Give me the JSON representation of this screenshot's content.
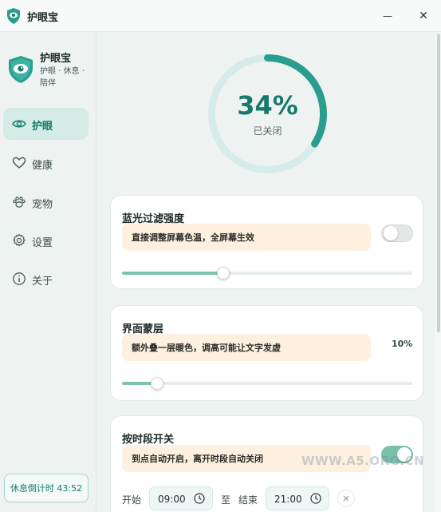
{
  "window": {
    "title": "护眼宝",
    "minimize_icon": "—",
    "close_icon": "✕"
  },
  "brand": {
    "name": "护眼宝",
    "tagline": "护眼 · 休息 · 陪伴"
  },
  "sidebar": {
    "items": [
      {
        "label": "护眼",
        "icon": "eye-icon",
        "active": true
      },
      {
        "label": "健康",
        "icon": "heart-icon",
        "active": false
      },
      {
        "label": "宠物",
        "icon": "paw-icon",
        "active": false
      },
      {
        "label": "设置",
        "icon": "gear-icon",
        "active": false
      },
      {
        "label": "关于",
        "icon": "info-icon",
        "active": false
      }
    ],
    "rest_timer": "休息倒计时 43:52"
  },
  "status": {
    "percent_text": "34%",
    "percent_value": 0.34,
    "state": "已关闭"
  },
  "cards": {
    "blue_light": {
      "title": "蓝光过滤强度",
      "description": "直接调整屏幕色温，全屏幕生效",
      "toggle_on": false,
      "slider_value": 0.35
    },
    "overlay": {
      "title": "界面蒙层",
      "description": "额外叠一层暖色，调高可能让文字发虚",
      "value_text": "10%",
      "slider_value": 0.12
    },
    "schedule": {
      "title": "按时段开关",
      "description": "到点自动开启，离开时段自动关闭",
      "toggle_on": true,
      "start_label": "开始",
      "start_time": "09:00",
      "to_label": "至",
      "end_label": "结束",
      "end_time": "21:00",
      "clear_icon": "✕"
    }
  },
  "colors": {
    "accent": "#17796b",
    "ring": "#2a9d8f",
    "ring_track": "#d6ecea",
    "desc_bg": "#fdf0df",
    "toggle_on": "#78c1a7"
  },
  "watermark": "WWW.A5.ORG.CN"
}
